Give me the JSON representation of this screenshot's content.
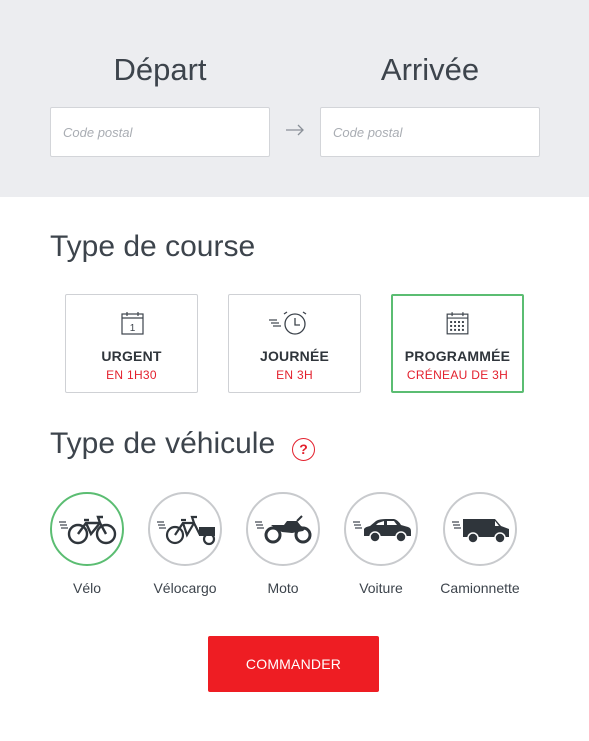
{
  "locations": {
    "depart": {
      "title": "Départ",
      "placeholder": "Code postal"
    },
    "arrivee": {
      "title": "Arrivée",
      "placeholder": "Code postal"
    }
  },
  "course": {
    "title": "Type de course",
    "options": [
      {
        "label": "URGENT",
        "sub": "EN 1H30",
        "icon": "calendar-day-icon",
        "day": "1",
        "selected": false
      },
      {
        "label": "JOURNÉE",
        "sub": "EN 3H",
        "icon": "fast-clock-icon",
        "selected": false
      },
      {
        "label": "PROGRAMMÉE",
        "sub": "CRÉNEAU DE 3H",
        "icon": "calendar-grid-icon",
        "selected": true
      }
    ]
  },
  "vehicule": {
    "title": "Type de véhicule",
    "help": "?",
    "options": [
      {
        "label": "Vélo",
        "icon": "bicycle-icon",
        "selected": true
      },
      {
        "label": "Vélocargo",
        "icon": "cargo-bike-icon",
        "selected": false
      },
      {
        "label": "Moto",
        "icon": "motorcycle-icon",
        "selected": false
      },
      {
        "label": "Voiture",
        "icon": "car-icon",
        "selected": false
      },
      {
        "label": "Camionnette",
        "icon": "van-icon",
        "selected": false
      }
    ]
  },
  "order_button": "COMMANDER",
  "colors": {
    "accent": "#ee1d23",
    "selected": "#5bbd72",
    "text": "#3d444c",
    "top_bg": "#ecedf0"
  }
}
